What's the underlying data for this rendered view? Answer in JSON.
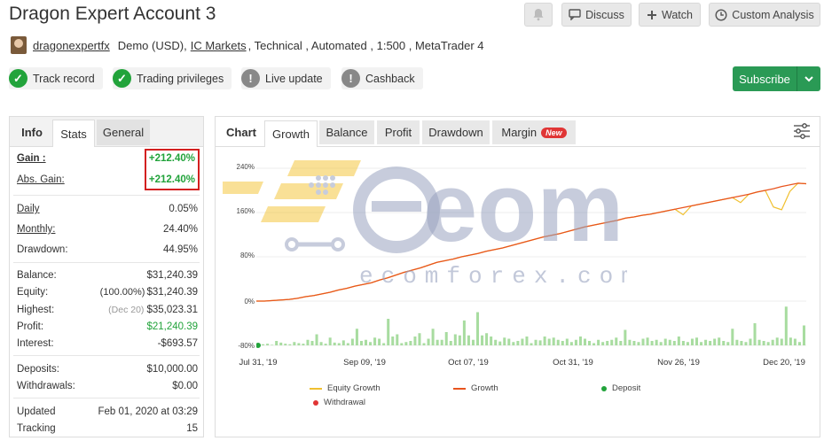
{
  "header": {
    "title": "Dragon Expert Account 3",
    "discuss_label": "Discuss",
    "watch_label": "Watch",
    "custom_analysis_label": "Custom Analysis",
    "username": "dragonexpertfx",
    "account_type": "Demo (USD),",
    "broker": "IC Markets",
    "details": ", Technical , Automated , 1:500 , MetaTrader 4"
  },
  "badges": {
    "track_record": "Track record",
    "trading_privileges": "Trading privileges",
    "live_update": "Live update",
    "cashback": "Cashback"
  },
  "subscribe_label": "Subscribe",
  "left_tabs": {
    "info": "Info",
    "stats": "Stats",
    "general": "General"
  },
  "stats": {
    "gain_label": "Gain :",
    "gain_value": "+212.40%",
    "abs_gain_label": "Abs. Gain:",
    "abs_gain_value": "+212.40%",
    "daily_label": "Daily",
    "daily_value": "0.05%",
    "monthly_label": "Monthly:",
    "monthly_value": "24.40%",
    "drawdown_label": "Drawdown:",
    "drawdown_value": "44.95%",
    "balance_label": "Balance:",
    "balance_value": "$31,240.39",
    "equity_label": "Equity:",
    "equity_pct": "(100.00%)",
    "equity_value": "$31,240.39",
    "highest_label": "Highest:",
    "highest_date": "(Dec 20)",
    "highest_value": "$35,023.31",
    "profit_label": "Profit:",
    "profit_value": "$21,240.39",
    "interest_label": "Interest:",
    "interest_value": "-$693.57",
    "deposits_label": "Deposits:",
    "deposits_value": "$10,000.00",
    "withdrawals_label": "Withdrawals:",
    "withdrawals_value": "$0.00",
    "updated_label": "Updated",
    "updated_value": "Feb 01, 2020 at 03:29",
    "tracking_label": "Tracking",
    "tracking_value": "15"
  },
  "right_tabs": {
    "chart": "Chart",
    "growth": "Growth",
    "balance": "Balance",
    "profit": "Profit",
    "drawdown": "Drawdown",
    "margin": "Margin",
    "new_badge": "New"
  },
  "watermark": {
    "brand": "eom",
    "site": "ecomforex.com"
  },
  "colors": {
    "accent_green": "#22a33b",
    "subscribe": "#2a9a55",
    "growth_line": "#e8541e",
    "equity_line": "#f0c030",
    "bars": "#a8dca0",
    "watermark": "#f5c842"
  },
  "chart_data": {
    "type": "line",
    "ylim": [
      -80,
      240
    ],
    "y_ticks": [
      "240%",
      "160%",
      "80%",
      "0%",
      "-80%"
    ],
    "x_ticks": [
      "Jul 31, '19",
      "Sep 09, '19",
      "Oct 07, '19",
      "Oct 31, '19",
      "Nov 26, '19",
      "Dec 20, '19"
    ],
    "legend": [
      "Equity Growth",
      "Growth",
      "Deposit",
      "Withdrawal"
    ],
    "growth": [
      0,
      0,
      1,
      2,
      3,
      5,
      8,
      10,
      13,
      16,
      20,
      23,
      27,
      30,
      33,
      38,
      42,
      47,
      52,
      56,
      60,
      65,
      70,
      73,
      76,
      80,
      83,
      86,
      90,
      93,
      96,
      100,
      104,
      108,
      112,
      116,
      119,
      122,
      126,
      130,
      134,
      137,
      140,
      143,
      146,
      150,
      152,
      155,
      157,
      160,
      163,
      166,
      169,
      172,
      175,
      178,
      181,
      184,
      187,
      190,
      193,
      197,
      200,
      203,
      207,
      210,
      213,
      212
    ],
    "equity_dips": [
      [
        52,
        156
      ],
      [
        59,
        178
      ],
      [
        63,
        170
      ],
      [
        64,
        165
      ],
      [
        65,
        198
      ]
    ],
    "bars": [
      4,
      2,
      3,
      1,
      8,
      5,
      3,
      2,
      6,
      4,
      3,
      10,
      8,
      20,
      6,
      3,
      14,
      5,
      4,
      9,
      4,
      12,
      30,
      8,
      10,
      6,
      14,
      12,
      4,
      48,
      16,
      20,
      4,
      6,
      8,
      16,
      22,
      4,
      12,
      30,
      10,
      10,
      24,
      8,
      20,
      18,
      45,
      18,
      10,
      60,
      18,
      22,
      16,
      10,
      7,
      14,
      12,
      6,
      8,
      12,
      16,
      4,
      10,
      9,
      16,
      12,
      14,
      10,
      8,
      12,
      6,
      10,
      16,
      12,
      8,
      4,
      10,
      6,
      8,
      10,
      14,
      8,
      28,
      10,
      8,
      6,
      12,
      14,
      8,
      10,
      6,
      12,
      10,
      8,
      16,
      8,
      6,
      12,
      14,
      6,
      10,
      8,
      12,
      14,
      8,
      6,
      30,
      10,
      8,
      6,
      12,
      40,
      10,
      8,
      6,
      10,
      14,
      12,
      70,
      14,
      12,
      6,
      36
    ],
    "deposit_x_index": 0
  }
}
